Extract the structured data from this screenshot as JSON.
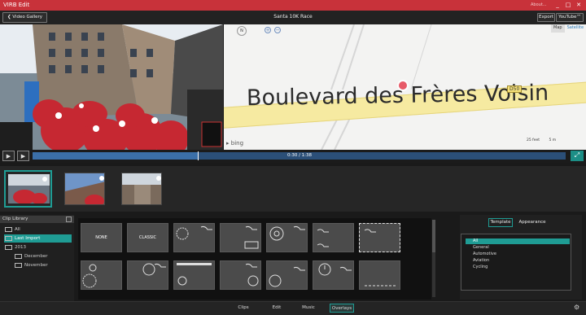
{
  "app": {
    "title": "VIRB Edit",
    "about": "About...",
    "win_min": "_",
    "win_max": "□",
    "win_close": "✕"
  },
  "toolbar": {
    "back": "Video Gallery",
    "project": "Santa 10K Race",
    "export": "Export",
    "youtube": "YouTube™"
  },
  "map": {
    "street": "Boulevard des Frères Voisin",
    "route": "D50",
    "tab_map": "Map",
    "tab_sat": "Satellite",
    "brand": "bing",
    "scale_feet": "25 feet",
    "scale_m": "5 m",
    "compass": "N",
    "zoom_in": "+",
    "zoom_out": "−"
  },
  "playback": {
    "time": "0:30 / 1:38",
    "play": "▶",
    "step": "▶",
    "progress": 0.31
  },
  "library": {
    "title": "Clip Library",
    "items": [
      "All",
      "Last Import",
      "2013",
      "December",
      "November"
    ]
  },
  "overlays": {
    "tiles": [
      "NONE",
      "CLASSIC",
      "",
      "",
      "",
      "",
      "",
      "",
      "",
      "",
      "",
      "",
      "",
      "",
      "",
      ""
    ]
  },
  "template": {
    "tab_template": "Template",
    "tab_appearance": "Appearance",
    "categories": [
      "All",
      "General",
      "Automotive",
      "Aviation",
      "Cycling"
    ]
  },
  "bottom": {
    "tabs": [
      "Clips",
      "Edit",
      "Music",
      "Overlays"
    ]
  },
  "colors": {
    "accent": "#1f9c94",
    "titlebar": "#c8323a",
    "timeline": "#3b6fa8"
  }
}
